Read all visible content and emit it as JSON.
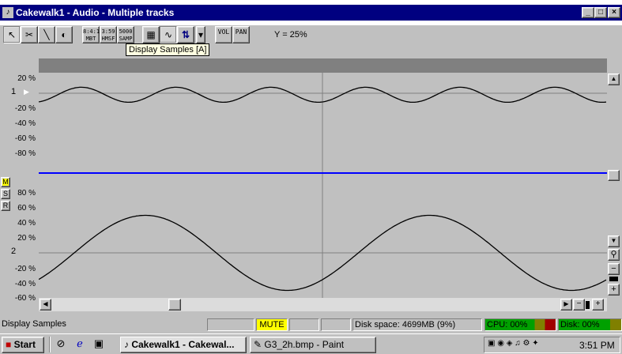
{
  "window": {
    "title": "Cakewalk1 - Audio - Multiple tracks",
    "app_icon": "keyboard-icon",
    "controls": {
      "minimize": "_",
      "maximize": "□",
      "close": "×"
    }
  },
  "toolbar": {
    "buttons": [
      {
        "name": "select-tool",
        "glyph": "↖"
      },
      {
        "name": "scissors-tool",
        "glyph": "✂"
      },
      {
        "name": "draw-line-tool",
        "glyph": "╲"
      },
      {
        "name": "scrub-tool",
        "glyph": "◐"
      },
      {
        "name": "mbt-button",
        "label": "8:4:1 MBT"
      },
      {
        "name": "hmsf-button",
        "label": "3:59 HMSF"
      },
      {
        "name": "samp-button",
        "label": "5000 SAMP"
      },
      {
        "name": "grid-button",
        "glyph": "▦"
      },
      {
        "name": "display-samples-button",
        "glyph": "∿"
      },
      {
        "name": "snap-button",
        "glyph": "⇅"
      },
      {
        "name": "dropdown-button",
        "glyph": "▾"
      },
      {
        "name": "vol-envelope-button",
        "label": "VOL"
      },
      {
        "name": "pan-envelope-button",
        "label": "PAN"
      }
    ],
    "y_readout": "Y = 25%",
    "tooltip": "Display Samples [A]"
  },
  "tracks": [
    {
      "number": "1",
      "ticks": [
        "20 %",
        "-20 %",
        "-40 %",
        "-60 %",
        "-80 %"
      ],
      "zero_label": "0"
    },
    {
      "number": "2",
      "ticks": [
        "80 %",
        "60 %",
        "40 %",
        "20 %",
        "-20 %",
        "-40 %",
        "-60 %"
      ],
      "msr": [
        "M",
        "S",
        "R"
      ]
    }
  ],
  "waveform_track1": {
    "cycles": 6,
    "amplitude_percent": 10,
    "offset_percent": -2
  },
  "waveform_track2": {
    "cycles": 2,
    "amplitude_percent": 50,
    "offset_percent": 0
  },
  "statusbar": {
    "message": "Display Samples",
    "mute": "MUTE",
    "disk_space": "Disk space: 4699MB (9%)",
    "cpu": "CPU: 00%",
    "disk": "Disk: 00%"
  },
  "taskbar": {
    "start": "Start",
    "tasks": [
      {
        "label": "Cakewalk1 - Cakewal..."
      },
      {
        "label": "G3_2h.bmp - Paint"
      }
    ],
    "clock": "3:51 PM"
  },
  "colors": {
    "title_bar": "#000080",
    "mute_bg": "#ffff00",
    "cpu_meter": "#00a000",
    "disk_meter": "#00a000",
    "divider_line": "#0000ff"
  }
}
